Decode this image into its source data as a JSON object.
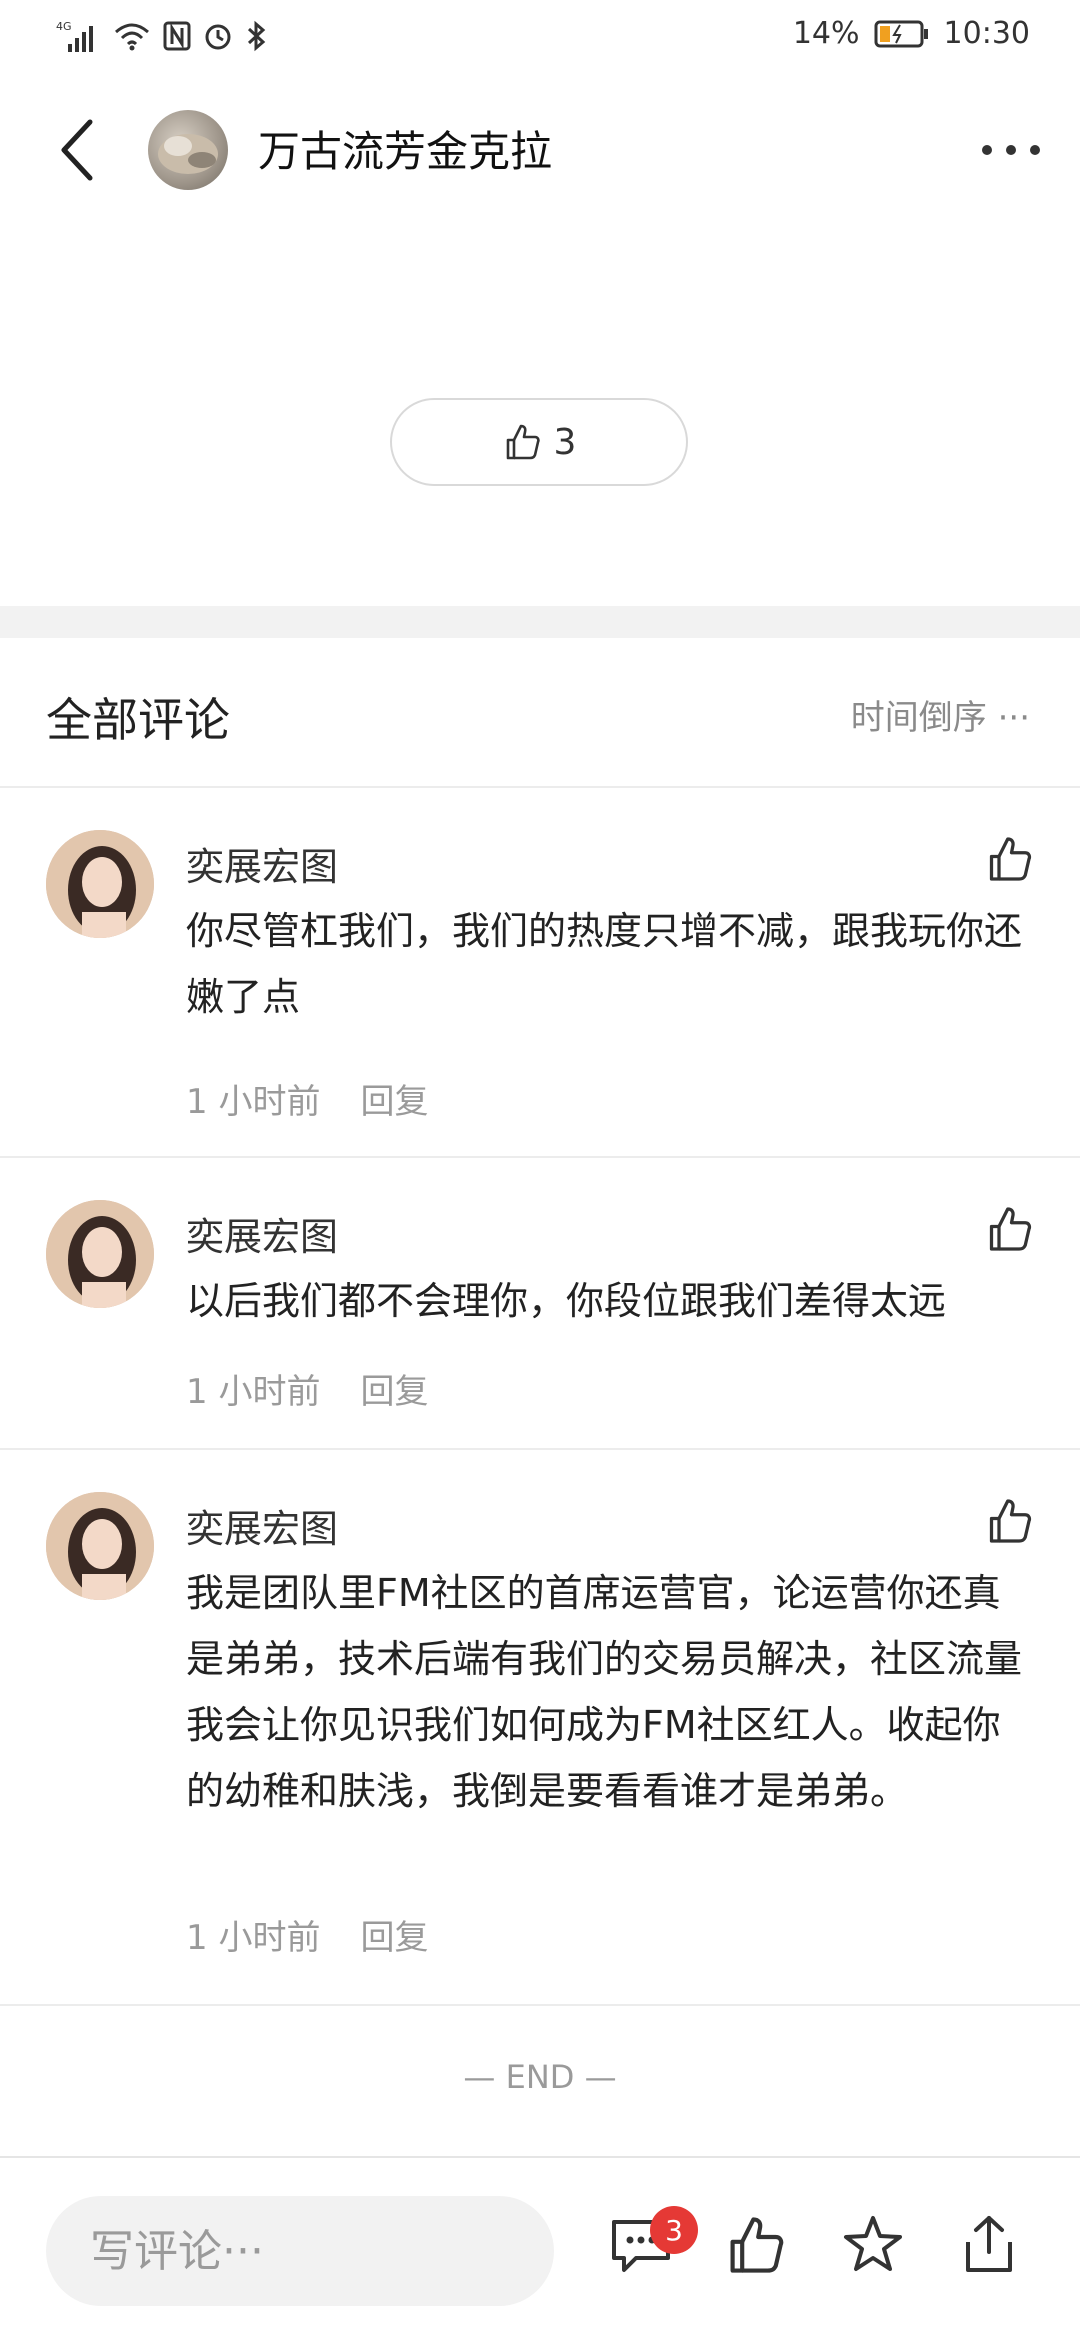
{
  "status_bar": {
    "network": "4G",
    "battery": "14%",
    "time": "10:30",
    "icons": [
      "signal-icon",
      "wifi-icon",
      "nfc-icon",
      "alarm-icon",
      "bluetooth-icon",
      "battery-icon"
    ]
  },
  "header": {
    "title": "万古流芳金克拉",
    "back_icon": "chevron-left-icon",
    "more_icon": "more-dots-icon"
  },
  "post": {
    "like_count": "3"
  },
  "comments_section": {
    "title": "全部评论",
    "sort_label": "时间倒序 ···"
  },
  "comments": [
    {
      "user": "奕展宏图",
      "text": "你尽管杠我们，我们的热度只增不减，跟我玩你还嫩了点",
      "time": "1 小时前",
      "reply": "回复"
    },
    {
      "user": "奕展宏图",
      "text": "以后我们都不会理你，你段位跟我们差得太远",
      "time": "1 小时前",
      "reply": "回复"
    },
    {
      "user": "奕展宏图",
      "text": "我是团队里FM社区的首席运营官，论运营你还真是弟弟，技术后端有我们的交易员解决，社区流量我会让你见识我们如何成为FM社区红人。收起你的幼稚和肤浅，我倒是要看看谁才是弟弟。",
      "time": "1 小时前",
      "reply": "回复"
    }
  ],
  "end_marker": "— END —",
  "bottom_bar": {
    "input_placeholder": "写评论···",
    "comment_badge": "3",
    "icons": [
      "comment-icon",
      "thumbs-up-icon",
      "star-icon",
      "share-icon"
    ]
  },
  "colors": {
    "badge": "#e53935",
    "muted_text": "#9a9a9a",
    "divider": "#ececec"
  }
}
